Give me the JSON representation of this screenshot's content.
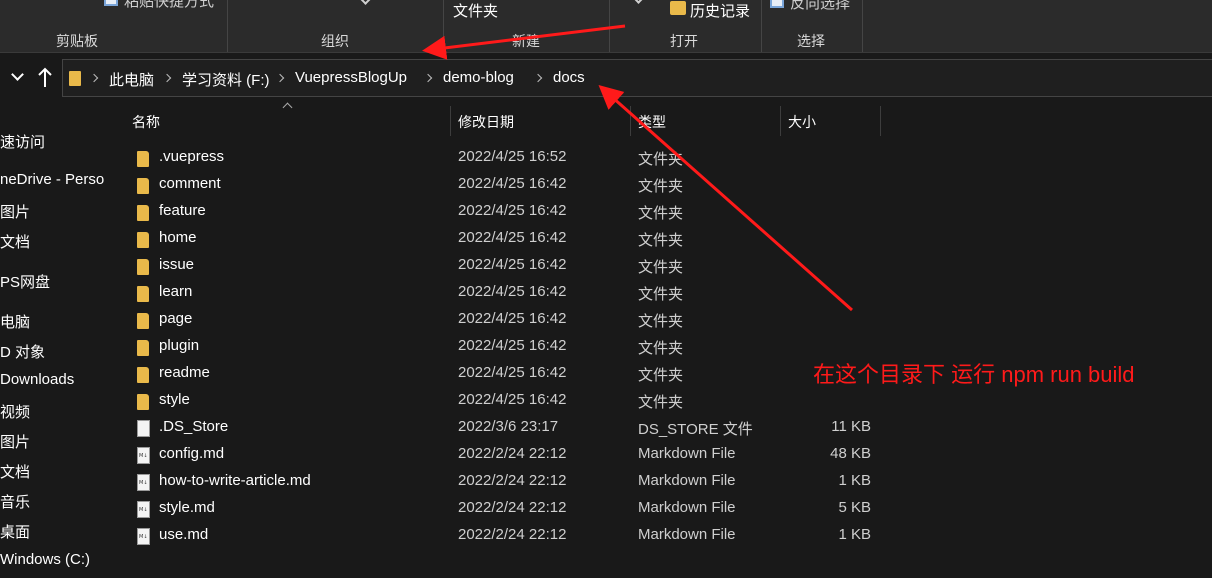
{
  "ribbon": {
    "paste_shortcut_partial": "粘贴快捷方式",
    "folder_partial": "文件夹",
    "history_label": "历史记录",
    "invert_select_partial": "反向选择",
    "groups": {
      "clipboard": "剪贴板",
      "organize": "组织",
      "new": "新建",
      "open": "打开",
      "select": "选择"
    }
  },
  "address": {
    "crumbs": [
      "此电脑",
      "学习资料 (F:)",
      "VuepressBlogUp",
      "demo-blog",
      "docs"
    ]
  },
  "sidebar": {
    "items": [
      "速访问",
      "neDrive - Perso",
      "图片",
      "文档",
      "PS网盘",
      "电脑",
      "D 对象",
      "Downloads",
      "视频",
      "图片",
      "文档",
      "音乐",
      "桌面",
      "Windows (C:)"
    ]
  },
  "columns": {
    "name": "名称",
    "date": "修改日期",
    "type": "类型",
    "size": "大小"
  },
  "files": [
    {
      "name": ".vuepress",
      "date": "2022/4/25 16:52",
      "type": "文件夹",
      "size": "",
      "icon": "folder-icon"
    },
    {
      "name": "comment",
      "date": "2022/4/25 16:42",
      "type": "文件夹",
      "size": "",
      "icon": "folder-icon"
    },
    {
      "name": "feature",
      "date": "2022/4/25 16:42",
      "type": "文件夹",
      "size": "",
      "icon": "folder-icon"
    },
    {
      "name": "home",
      "date": "2022/4/25 16:42",
      "type": "文件夹",
      "size": "",
      "icon": "folder-icon"
    },
    {
      "name": "issue",
      "date": "2022/4/25 16:42",
      "type": "文件夹",
      "size": "",
      "icon": "folder-icon"
    },
    {
      "name": "learn",
      "date": "2022/4/25 16:42",
      "type": "文件夹",
      "size": "",
      "icon": "folder-icon"
    },
    {
      "name": "page",
      "date": "2022/4/25 16:42",
      "type": "文件夹",
      "size": "",
      "icon": "folder-icon"
    },
    {
      "name": "plugin",
      "date": "2022/4/25 16:42",
      "type": "文件夹",
      "size": "",
      "icon": "folder-icon"
    },
    {
      "name": "readme",
      "date": "2022/4/25 16:42",
      "type": "文件夹",
      "size": "",
      "icon": "folder-icon"
    },
    {
      "name": "style",
      "date": "2022/4/25 16:42",
      "type": "文件夹",
      "size": "",
      "icon": "folder-icon"
    },
    {
      "name": ".DS_Store",
      "date": "2022/3/6 23:17",
      "type": "DS_STORE 文件",
      "size": "11 KB",
      "icon": "file-icon"
    },
    {
      "name": "config.md",
      "date": "2022/2/24 22:12",
      "type": "Markdown File",
      "size": "48 KB",
      "icon": "markdown-icon"
    },
    {
      "name": "how-to-write-article.md",
      "date": "2022/2/24 22:12",
      "type": "Markdown File",
      "size": "1 KB",
      "icon": "markdown-icon"
    },
    {
      "name": "style.md",
      "date": "2022/2/24 22:12",
      "type": "Markdown File",
      "size": "5 KB",
      "icon": "markdown-icon"
    },
    {
      "name": "use.md",
      "date": "2022/2/24 22:12",
      "type": "Markdown File",
      "size": "1 KB",
      "icon": "markdown-icon"
    }
  ],
  "annotation": {
    "note": "在这个目录下 运行 npm run build",
    "color": "#ff1a1a"
  },
  "theme": {
    "background": "#191919",
    "ribbon": "#2b2b2b",
    "folder_color": "#e9b94a"
  }
}
